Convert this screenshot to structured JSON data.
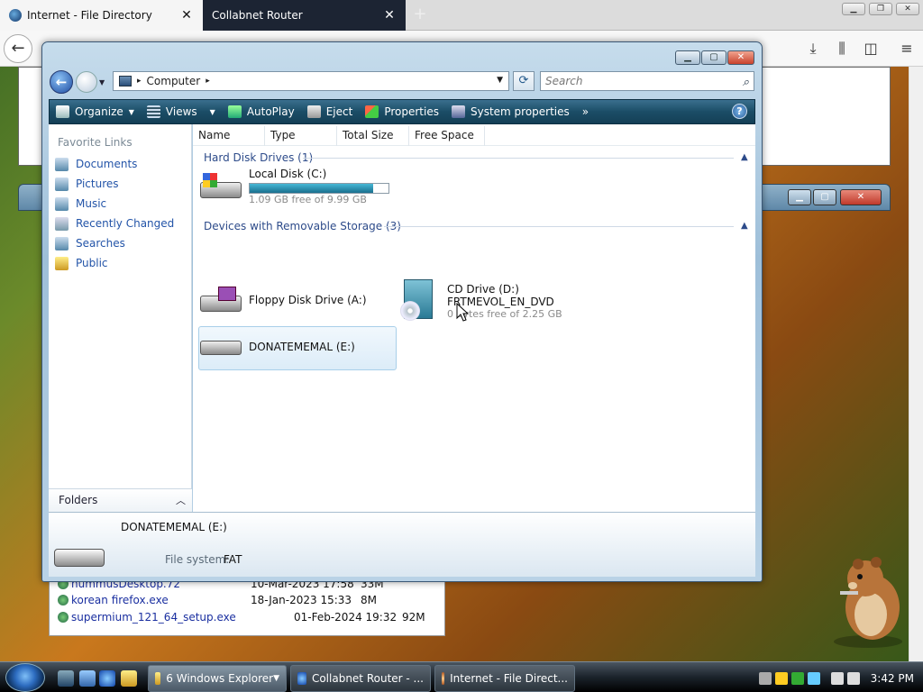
{
  "browser": {
    "tabs": [
      {
        "title": "Internet - File Directory",
        "close": "✕"
      },
      {
        "title": "Collabnet Router",
        "close": "✕"
      }
    ],
    "new_tab": "+",
    "back": "←"
  },
  "downloads": [
    {
      "name": "nummusDesktop.72",
      "date": "10-Mar-2023 17:58",
      "size": "33M"
    },
    {
      "name": "korean firefox.exe",
      "date": "18-Jan-2023 15:33",
      "size": "8M"
    },
    {
      "name": "supermium_121_64_setup.exe",
      "date": "01-Feb-2024 19:32",
      "size": "92M"
    }
  ],
  "explorer": {
    "address": {
      "crumb": "Computer",
      "sep": "▸"
    },
    "search_placeholder": "Search",
    "commands": [
      {
        "label": "Organize",
        "caret": "▼"
      },
      {
        "label": "Views",
        "caret": "▼"
      },
      {
        "label": "AutoPlay"
      },
      {
        "label": "Eject"
      },
      {
        "label": "Properties"
      },
      {
        "label": "System properties"
      },
      {
        "label": "»"
      }
    ],
    "help": "?",
    "favorites_title": "Favorite Links",
    "favorites": [
      "Documents",
      "Pictures",
      "Music",
      "Recently Changed",
      "Searches",
      "Public"
    ],
    "folders_label": "Folders",
    "columns": [
      "Name",
      "Type",
      "Total Size",
      "Free Space"
    ],
    "groups": {
      "hdd": "Hard Disk Drives (1)",
      "removable": "Devices with Removable Storage (3)"
    },
    "drives": {
      "c": {
        "label": "Local Disk (C:)",
        "free_text": "1.09 GB free of 9.99 GB",
        "used_fraction": 0.89
      },
      "a": {
        "label": "Floppy Disk Drive (A:)"
      },
      "d": {
        "label": "CD Drive (D:)",
        "volume": "FRTMEVOL_EN_DVD",
        "free_text": "0 bytes free of 2.25 GB"
      },
      "e": {
        "label": "DONATEMEMAL (E:)"
      }
    },
    "details": {
      "name": "DONATEMEMAL (E:)",
      "fs_label": "File system:",
      "fs_value": "FAT"
    }
  },
  "taskbar": {
    "tasks": [
      "6 Windows Explorer",
      "Collabnet Router - ...",
      "Internet - File Direct..."
    ],
    "clock": "3:42 PM"
  }
}
